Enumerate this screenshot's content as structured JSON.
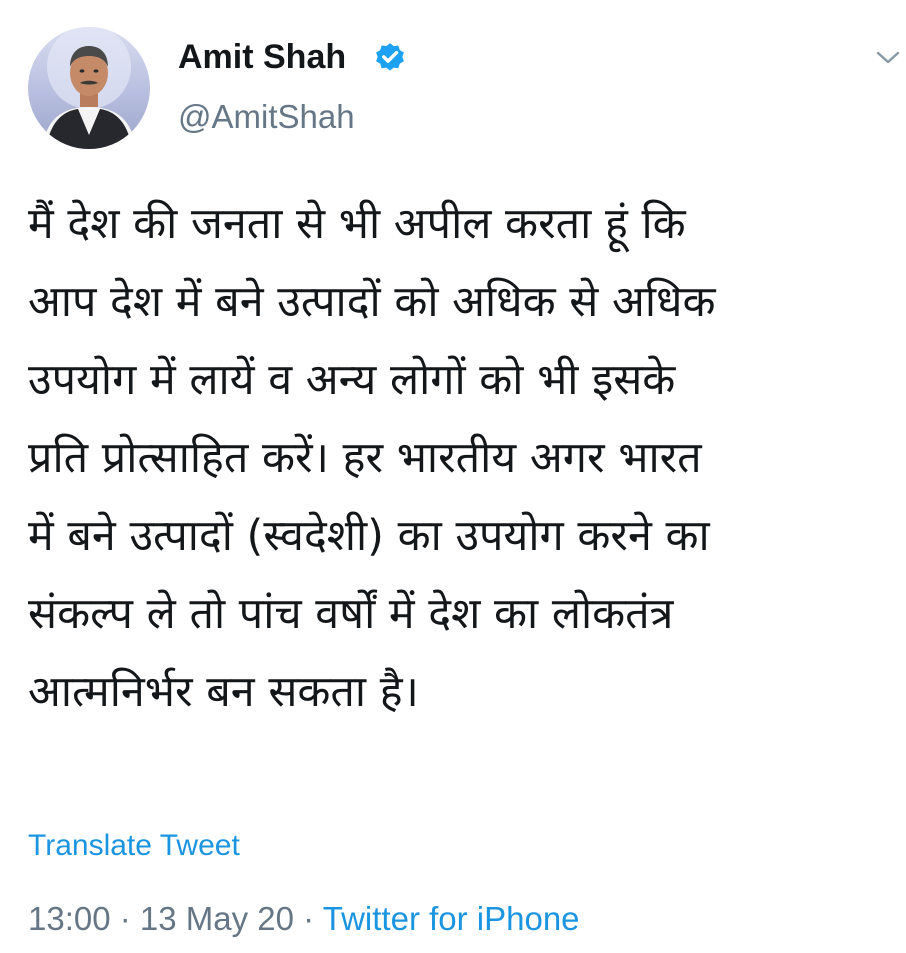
{
  "author": {
    "display_name": "Amit Shah",
    "handle": "@AmitShah",
    "verified": true,
    "avatar_icon": "profile-photo-avatar"
  },
  "icons": {
    "verified": "verified-badge-icon",
    "menu": "chevron-down-icon"
  },
  "tweet": {
    "lines": [
      "मैं देश की जनता से भी अपील करता हूं कि",
      "आप देश में बने उत्पादों को अधिक से अधिक",
      "उपयोग में लायें व अन्य लोगों को भी इसके",
      "प्रति प्रोत्साहित करें। हर भारतीय अगर भारत",
      "में बने उत्पादों (स्वदेशी) का उपयोग करने का",
      "संकल्प ले तो पांच वर्षों में देश का लोकतंत्र",
      "आत्मनिर्भर बन सकता है।"
    ]
  },
  "translate_label": "Translate Tweet",
  "meta": {
    "time": "13:00",
    "separator": " · ",
    "date": "13 May 20",
    "source": "Twitter for iPhone"
  },
  "colors": {
    "link": "#1b95e0",
    "secondary_text": "#657786",
    "primary_text": "#14171a",
    "verified_badge": "#1da1f2"
  }
}
